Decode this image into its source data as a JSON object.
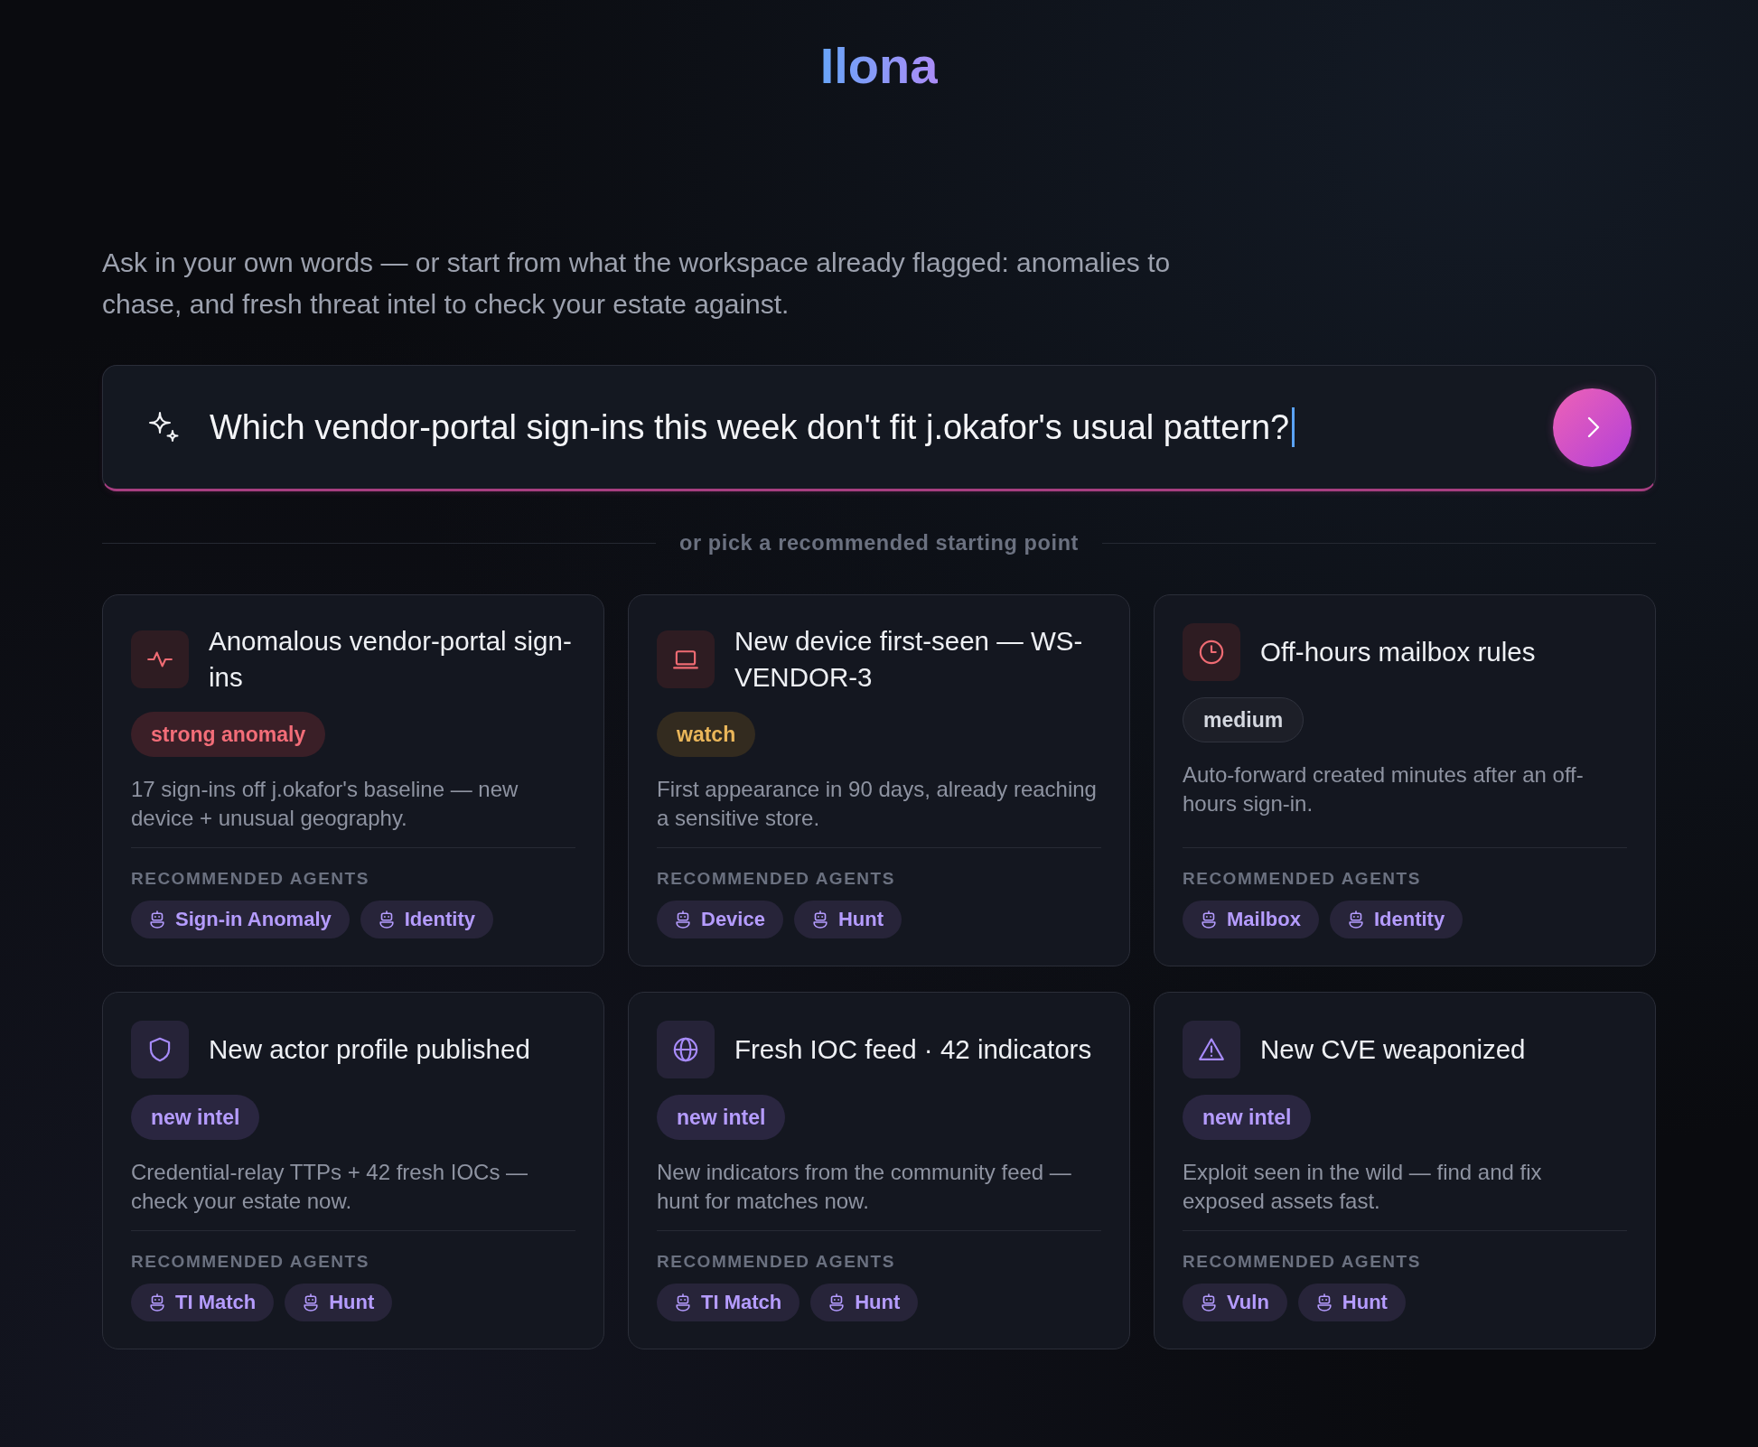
{
  "app": {
    "title": "Ilona"
  },
  "intro": "Ask in your own words — or start from what the workspace already flagged: anomalies to chase, and fresh threat intel to check your estate against.",
  "search": {
    "value": "Which vendor-portal sign-ins this week don't fit j.okafor's usual pattern?",
    "focused": true
  },
  "divider_label": "or pick a recommended starting point",
  "cards": [
    {
      "kind": "signin",
      "title": "Anomalous vendor-portal sign-ins",
      "badge": {
        "label": "strong anomaly",
        "kind": "strong"
      },
      "description": "17 sign-ins off j.okafor's baseline — new device + unusual geography.",
      "agents_label": "RECOMMENDED AGENTS",
      "agents": [
        "Sign-in Anomaly",
        "Identity"
      ]
    },
    {
      "kind": "device",
      "title": "New device first-seen — WS-VENDOR-3",
      "badge": {
        "label": "watch",
        "kind": "watch"
      },
      "description": "First appearance in 90 days, already reaching a sensitive store.",
      "agents_label": "RECOMMENDED AGENTS",
      "agents": [
        "Device",
        "Hunt"
      ]
    },
    {
      "kind": "mailbox",
      "title": "Off-hours mailbox rules",
      "badge": {
        "label": "medium",
        "kind": "medium"
      },
      "description": "Auto-forward created minutes after an off-hours sign-in.",
      "agents_label": "RECOMMENDED AGENTS",
      "agents": [
        "Mailbox",
        "Identity"
      ]
    },
    {
      "kind": "actor",
      "title": "New actor profile published",
      "badge": {
        "label": "new intel",
        "kind": "intel"
      },
      "description": "Credential-relay TTPs + 42 fresh IOCs — check your estate now.",
      "agents_label": "RECOMMENDED AGENTS",
      "agents": [
        "TI Match",
        "Hunt"
      ]
    },
    {
      "kind": "feed",
      "title": "Fresh IOC feed · 42 indicators",
      "badge": {
        "label": "new intel",
        "kind": "intel"
      },
      "description": "New indicators from the community feed — hunt for matches now.",
      "agents_label": "RECOMMENDED AGENTS",
      "agents": [
        "TI Match",
        "Hunt"
      ]
    },
    {
      "kind": "vulnerability",
      "title": "New CVE weaponized",
      "badge": {
        "label": "new intel",
        "kind": "intel"
      },
      "description": "Exploit seen in the wild — find and fix exposed assets fast.",
      "agents_label": "RECOMMENDED AGENTS",
      "agents": [
        "Vuln",
        "Hunt"
      ]
    }
  ]
}
